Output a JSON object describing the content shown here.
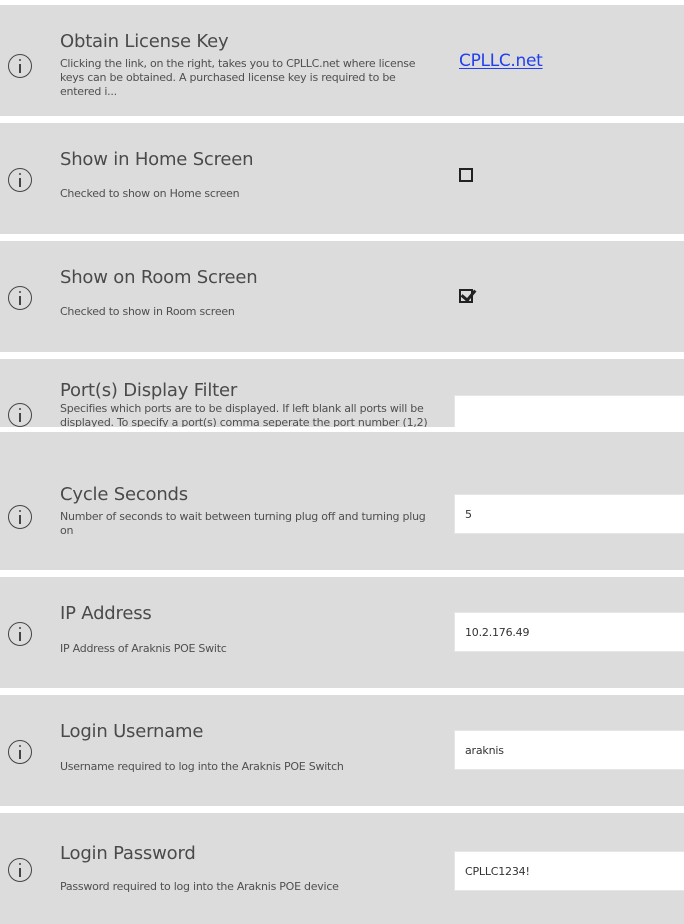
{
  "settings": [
    {
      "title": "Obtain License Key",
      "description": "Clicking the link, on the right, takes you to CPLLC.net where license keys can be obtained.  A purchased license key is required to be entered i...",
      "link_text": "CPLLC.net"
    },
    {
      "title": "Show in Home Screen",
      "description": "Checked to show on Home screen",
      "checked": false
    },
    {
      "title": "Show on Room Screen",
      "description": "Checked to show in Room screen",
      "checked": true
    },
    {
      "title": "Port(s) Display Filter",
      "description": "Specifies which ports are to be displayed.  If left blank all ports will be displayed. To specify a port(s) comma seperate the port number (1,2)",
      "value": ""
    },
    {
      "title": "Cycle Seconds",
      "description": "Number of seconds to wait between turning plug off and turning plug on",
      "value": "5"
    },
    {
      "title": "IP Address",
      "description": "IP Address of Araknis POE Switc",
      "value": "10.2.176.49"
    },
    {
      "title": "Login Username",
      "description": "Username required to log into the Araknis POE Switch",
      "value": "araknis"
    },
    {
      "title": "Login Password",
      "description": "Password required to log into the Araknis POE device",
      "value": "CPLLC1234!"
    }
  ],
  "colors": {
    "row_background": "#dcdcdc",
    "link": "#1f3ff0",
    "separator": "#ffffff"
  },
  "icons": {
    "info": "info-circle-icon"
  }
}
